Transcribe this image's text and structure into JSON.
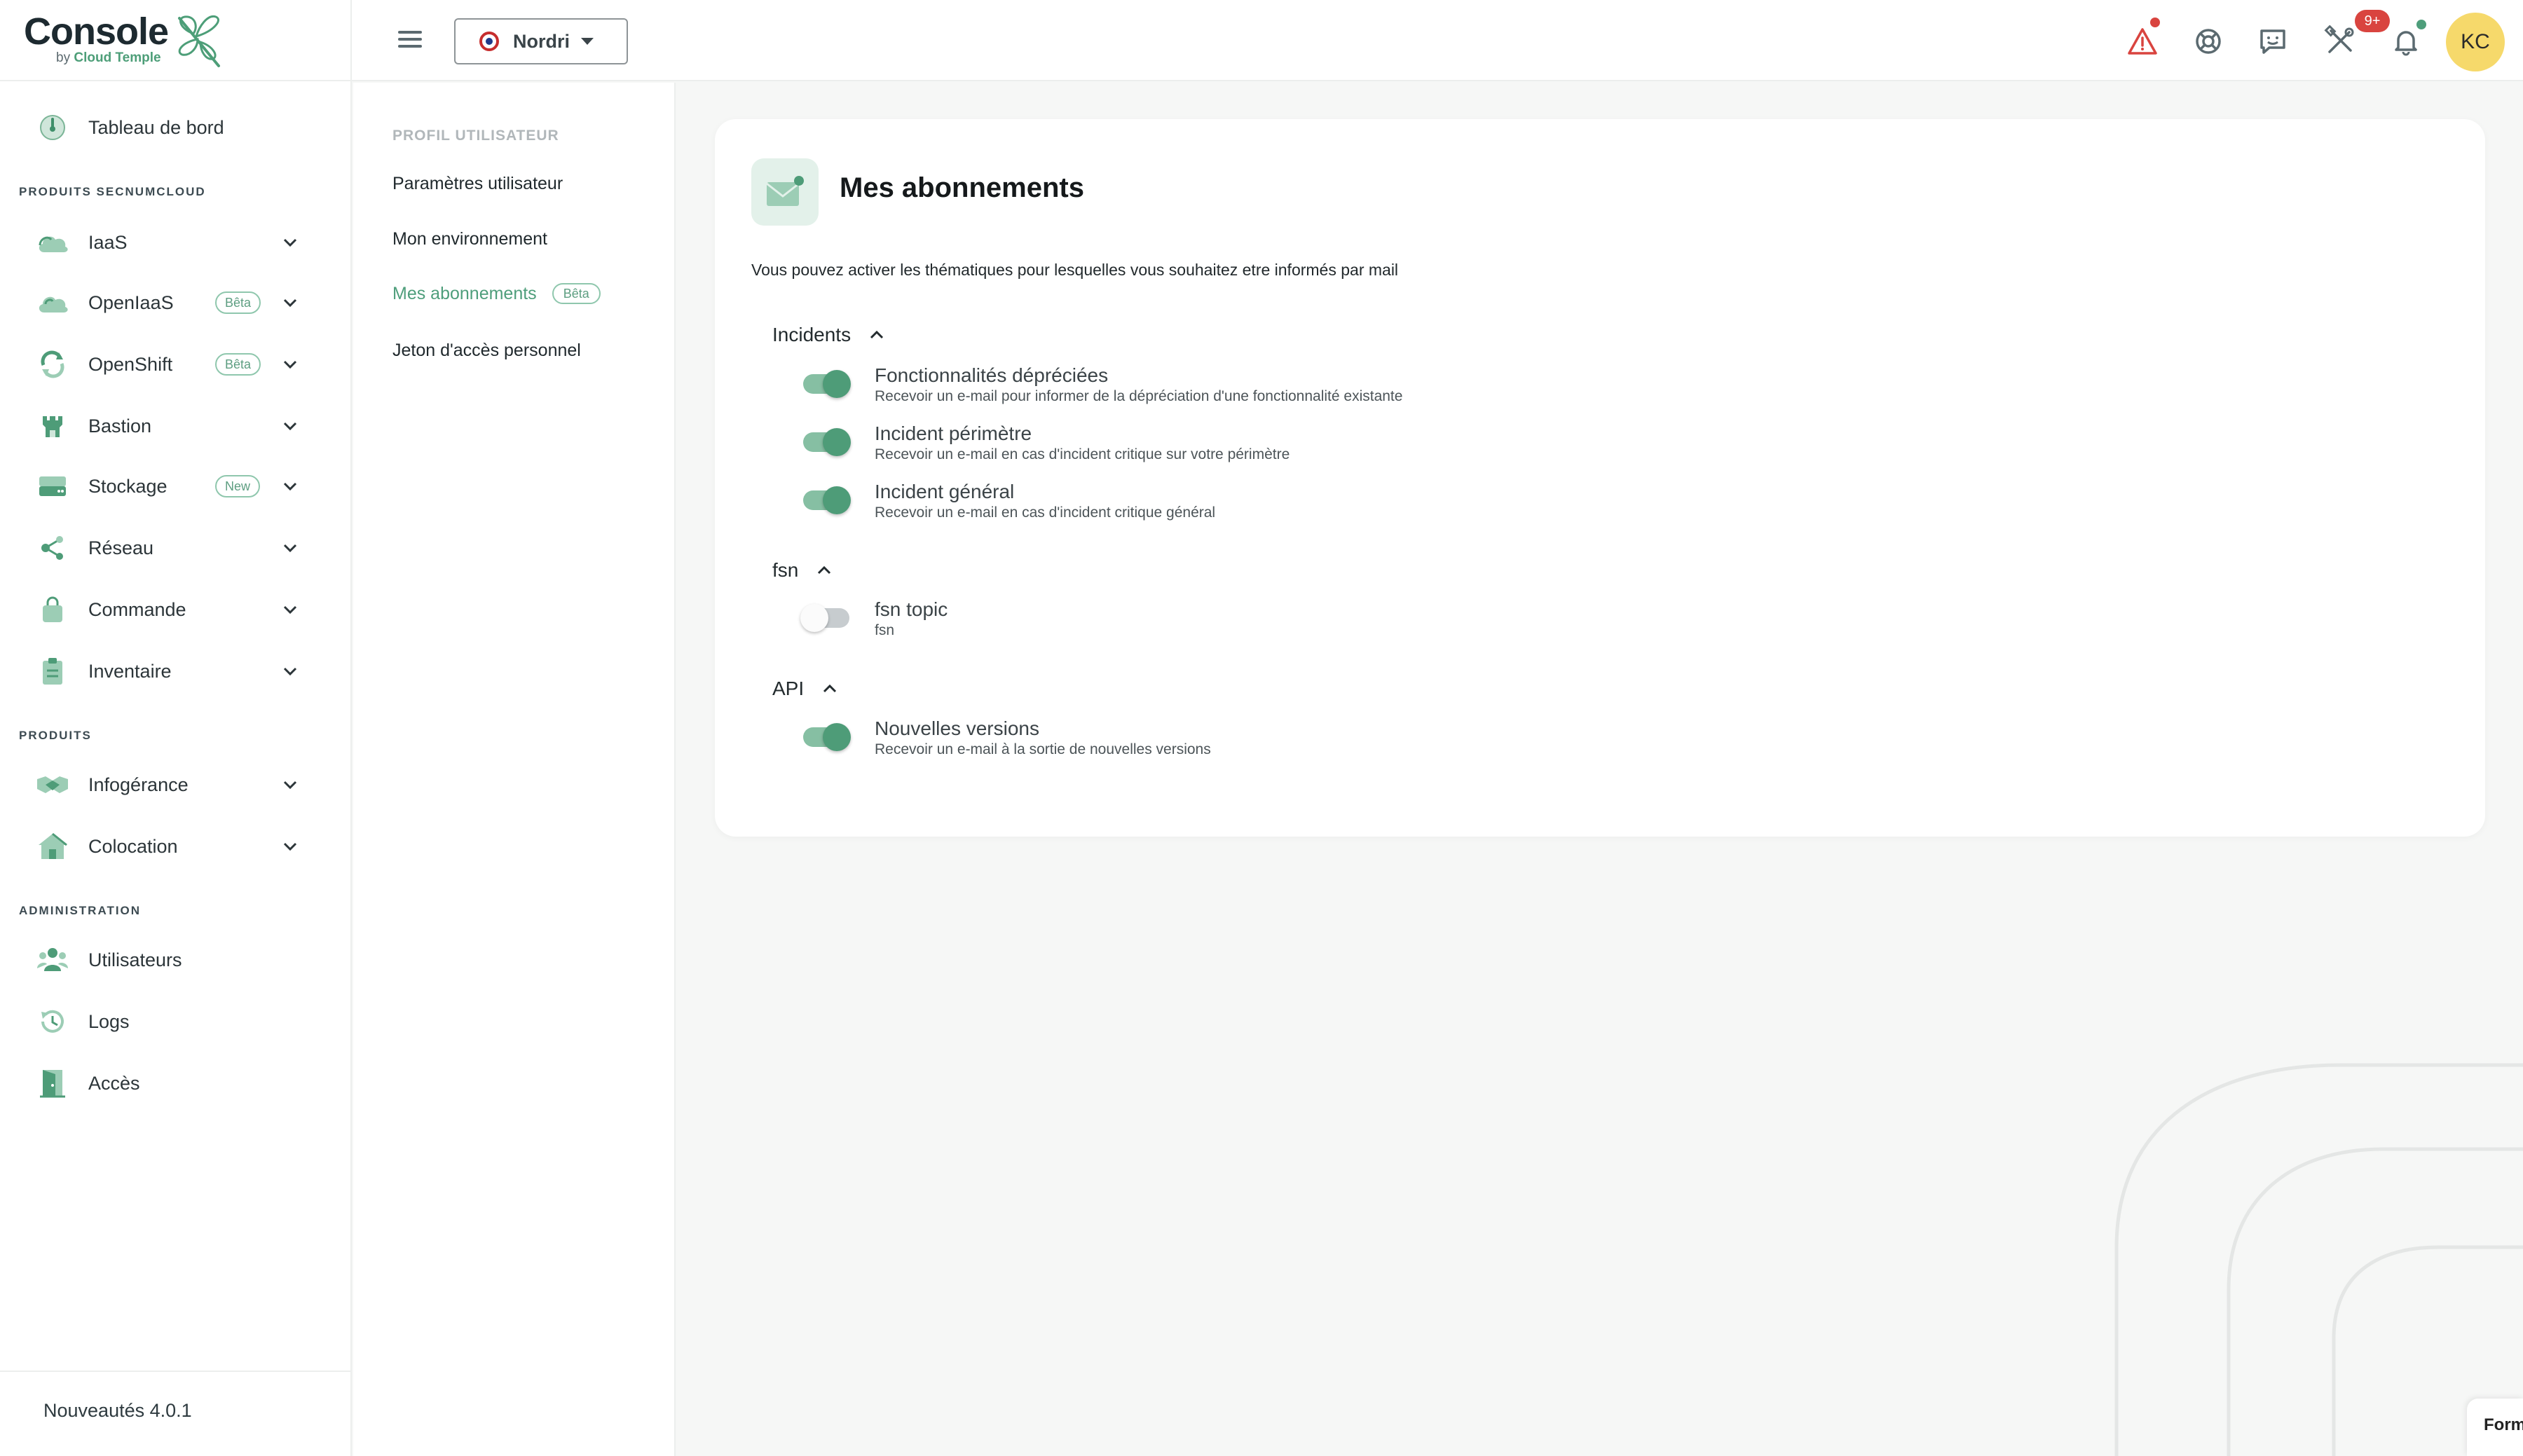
{
  "app": {
    "logo_word": "Console",
    "logo_by": "by",
    "logo_company": "Cloud Temple"
  },
  "sidebar": {
    "dashboard": "Tableau de bord",
    "section_secnum": "PRODUITS SECNUMCLOUD",
    "section_products": "PRODUITS",
    "section_admin": "ADMINISTRATION",
    "items": [
      {
        "label": "IaaS",
        "icon": "cloud-icon"
      },
      {
        "label": "OpenIaaS",
        "badge": "Bêta",
        "icon": "cloud-stack-icon"
      },
      {
        "label": "OpenShift",
        "badge": "Bêta",
        "icon": "refresh-icon"
      },
      {
        "label": "Bastion",
        "icon": "castle-icon"
      },
      {
        "label": "Stockage",
        "badge": "New",
        "icon": "storage-icon"
      },
      {
        "label": "Réseau",
        "icon": "network-icon"
      },
      {
        "label": "Commande",
        "icon": "shopping-bag-icon"
      },
      {
        "label": "Inventaire",
        "icon": "clipboard-icon"
      }
    ],
    "products": [
      {
        "label": "Infogérance",
        "icon": "handshake-icon"
      },
      {
        "label": "Colocation",
        "icon": "house-icon"
      }
    ],
    "admin": [
      {
        "label": "Utilisateurs",
        "icon": "users-icon"
      },
      {
        "label": "Logs",
        "icon": "history-icon"
      },
      {
        "label": "Accès",
        "icon": "door-icon"
      }
    ],
    "news": "Nouveautés 4.0.1"
  },
  "topbar": {
    "tenant": "Nordri",
    "notif_count": "9+",
    "avatar_initials": "KC",
    "alert_color": "#d9443f",
    "accent": "#4e9e7b"
  },
  "subnav": {
    "title": "PROFIL UTILISATEUR",
    "items": [
      {
        "label": "Paramètres utilisateur"
      },
      {
        "label": "Mon environnement"
      },
      {
        "label": "Mes abonnements",
        "badge": "Bêta",
        "active": true
      },
      {
        "label": "Jeton d'accès personnel"
      }
    ]
  },
  "main": {
    "title": "Mes abonnements",
    "description": "Vous pouvez activer les thématiques pour lesquelles vous souhaitez etre informés par mail",
    "groups": [
      {
        "name": "Incidents",
        "items": [
          {
            "title": "Fonctionnalités dépréciées",
            "subtitle": "Recevoir un e-mail pour informer de la dépréciation d'une fonctionnalité existante",
            "enabled": true
          },
          {
            "title": "Incident périmètre",
            "subtitle": "Recevoir un e-mail en cas d'incident critique sur votre périmètre",
            "enabled": true
          },
          {
            "title": "Incident général",
            "subtitle": "Recevoir un e-mail en cas d'incident critique général",
            "enabled": true
          }
        ]
      },
      {
        "name": "fsn",
        "items": [
          {
            "title": "fsn topic",
            "subtitle": "fsn",
            "enabled": false
          }
        ]
      },
      {
        "name": "API",
        "items": [
          {
            "title": "Nouvelles versions",
            "subtitle": "Recevoir un e-mail à la sortie de nouvelles versions",
            "enabled": true
          }
        ]
      }
    ]
  },
  "form_tab": "Form"
}
